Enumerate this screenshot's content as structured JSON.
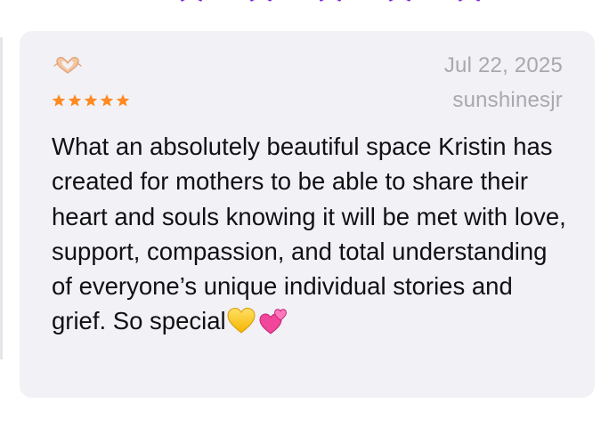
{
  "colors": {
    "accent_purple": "#7a2bd9",
    "rating_orange": "#ff8a1f",
    "card_background": "#f1f1f6",
    "meta_gray": "#a8a8ae"
  },
  "rating_prompt": {
    "star_count": 5,
    "icon": "star-outline-icon"
  },
  "review": {
    "title_icon": "heart-hands-icon",
    "date": "Jul 22, 2025",
    "author": "sunshinesjr",
    "rating": 5,
    "rating_icon": "star-filled-icon",
    "body_text": "What an absolutely beautiful space Kristin has created for mothers to be able to share their heart and souls knowing it will be met with love, support, compassion, and total understanding of everyone’s unique individual stories and grief. So special",
    "trailing_emoji_icons": [
      "yellow-heart-icon",
      "two-hearts-icon"
    ]
  }
}
